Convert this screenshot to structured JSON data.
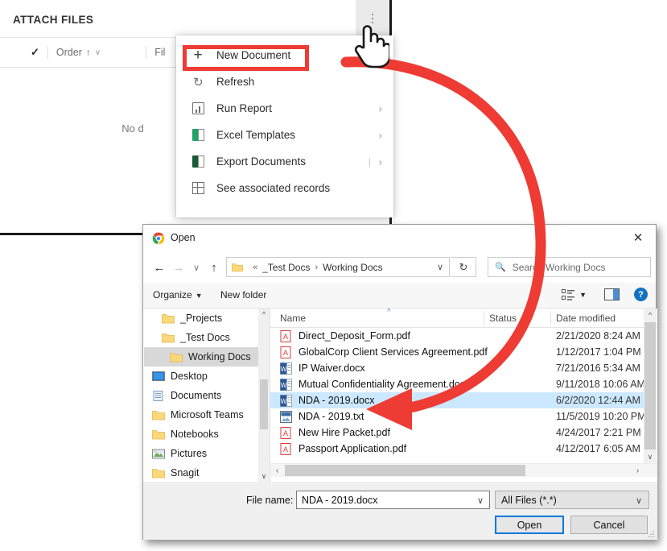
{
  "crm": {
    "panel_title": "ATTACH FILES",
    "kebab_name": "more-commands",
    "grid": {
      "check": "✓",
      "col_order": "Order",
      "sort_arrow": "↑",
      "col_order_caret": "∨",
      "col_file": "Fil"
    },
    "empty_text": "No d"
  },
  "menu": {
    "items": [
      {
        "label": "New Document",
        "icon": "plus-icon",
        "chevron": "",
        "pipe": ""
      },
      {
        "label": "Refresh",
        "icon": "refresh-icon",
        "chevron": "",
        "pipe": ""
      },
      {
        "label": "Run Report",
        "icon": "report-icon",
        "chevron": "›",
        "pipe": ""
      },
      {
        "label": "Excel Templates",
        "icon": "excel-icon",
        "chevron": "›",
        "pipe": ""
      },
      {
        "label": "Export Documents",
        "icon": "excel-export-icon",
        "chevron": "›",
        "pipe": "|"
      },
      {
        "label": "See associated records",
        "icon": "grid-records-icon",
        "chevron": "",
        "pipe": ""
      }
    ],
    "highlight_color": "#ee3b33",
    "highlighted_item": "New Document"
  },
  "annotation": {
    "arrow_color": "#ee3b33",
    "cursor": "pointing-hand-cursor"
  },
  "dialog": {
    "title": "Open",
    "title_icon": "chrome-icon",
    "close_label": "✕",
    "nav": {
      "back": "←",
      "forward": "→",
      "recent": "∨",
      "up": "↑",
      "breadcrumb": [
        "_Test Docs",
        "Working Docs"
      ],
      "breadcrumb_prefix": "«",
      "breadcrumb_sep": "›",
      "refresh": "↻",
      "search_placeholder": "Search Working Docs"
    },
    "commands": {
      "organize": "Organize",
      "organize_caret": "▼",
      "new_folder": "New folder",
      "view_icon": "view-layout-icon",
      "view_caret": "▼",
      "preview_pane_icon": "preview-pane-icon",
      "help_icon": "help-icon",
      "help_glyph": "?"
    },
    "tree": [
      {
        "label": "_Projects",
        "icon": "folder-icon",
        "indent": 1,
        "selected": false
      },
      {
        "label": "_Test Docs",
        "icon": "folder-icon",
        "indent": 1,
        "selected": false
      },
      {
        "label": "Working Docs",
        "icon": "folder-icon",
        "indent": 2,
        "selected": true
      },
      {
        "label": "Desktop",
        "icon": "desktop-icon",
        "indent": 0,
        "selected": false
      },
      {
        "label": "Documents",
        "icon": "documents-icon",
        "indent": 0,
        "selected": false
      },
      {
        "label": "Microsoft Teams",
        "icon": "folder-icon",
        "indent": 0,
        "selected": false
      },
      {
        "label": "Notebooks",
        "icon": "folder-icon",
        "indent": 0,
        "selected": false
      },
      {
        "label": "Pictures",
        "icon": "pictures-icon",
        "indent": 0,
        "selected": false
      },
      {
        "label": "Snagit",
        "icon": "folder-icon",
        "indent": 0,
        "selected": false
      }
    ],
    "columns": [
      "Name",
      "Status",
      "Date modified"
    ],
    "files": [
      {
        "name": "Direct_Deposit_Form.pdf",
        "icon": "pdf-icon",
        "date": "2/21/2020 8:24 AM",
        "selected": false
      },
      {
        "name": "GlobalCorp Client Services Agreement.pdf",
        "icon": "pdf-icon",
        "date": "1/12/2017 1:04 PM",
        "selected": false
      },
      {
        "name": "IP Waiver.docx",
        "icon": "word-icon",
        "date": "7/21/2016 5:34 AM",
        "selected": false
      },
      {
        "name": "Mutual Confidentiality Agreement.docx",
        "icon": "word-icon",
        "date": "9/11/2018 10:06 AM",
        "selected": false
      },
      {
        "name": "NDA - 2019.docx",
        "icon": "word-icon",
        "date": "6/2/2020 12:44 AM",
        "selected": true
      },
      {
        "name": "NDA - 2019.txt",
        "icon": "text-icon",
        "date": "11/5/2019 10:20 PM",
        "selected": false
      },
      {
        "name": "New Hire Packet.pdf",
        "icon": "pdf-icon",
        "date": "4/24/2017 2:21 PM",
        "selected": false
      },
      {
        "name": "Passport Application.pdf",
        "icon": "pdf-icon",
        "date": "4/12/2017 6:05 AM",
        "selected": false
      }
    ],
    "footer": {
      "file_name_label": "File name:",
      "file_name_value": "NDA - 2019.docx",
      "file_type_value": "All Files (*.*)",
      "open_button": "Open",
      "cancel_button": "Cancel",
      "dropdown_caret": "∨"
    }
  }
}
